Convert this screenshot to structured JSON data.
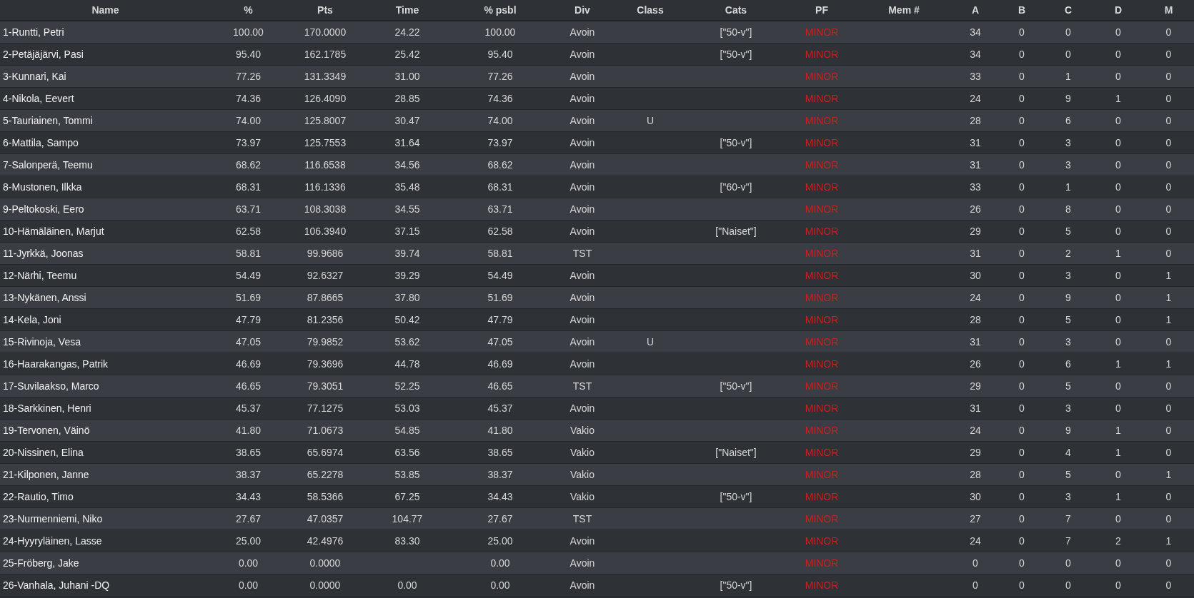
{
  "table": {
    "columns": [
      {
        "label": "Name",
        "kind": "text"
      },
      {
        "label": "%",
        "kind": "number"
      },
      {
        "label": "Pts",
        "kind": "number"
      },
      {
        "label": "Time",
        "kind": "number"
      },
      {
        "label": "% psbl",
        "kind": "number"
      },
      {
        "label": "Div",
        "kind": "number"
      },
      {
        "label": "Class",
        "kind": "number"
      },
      {
        "label": "Cats",
        "kind": "number"
      },
      {
        "label": "PF",
        "kind": "flag"
      },
      {
        "label": "Mem #",
        "kind": "number"
      },
      {
        "label": "A",
        "kind": "number"
      },
      {
        "label": "B",
        "kind": "number"
      },
      {
        "label": "C",
        "kind": "number"
      },
      {
        "label": "D",
        "kind": "number"
      },
      {
        "label": "M",
        "kind": "number"
      }
    ],
    "rows": [
      {
        "cells": [
          "1-Runtti, Petri",
          "100.00",
          "170.0000",
          "24.22",
          "100.00",
          "Avoin",
          null,
          "[\"50-v\"]",
          "MINOR",
          null,
          "34",
          "0",
          "0",
          "0",
          "0"
        ]
      },
      {
        "cells": [
          "2-Petäjäjärvi, Pasi",
          "95.40",
          "162.1785",
          "25.42",
          "95.40",
          "Avoin",
          null,
          "[\"50-v\"]",
          "MINOR",
          null,
          "34",
          "0",
          "0",
          "0",
          "0"
        ]
      },
      {
        "cells": [
          "3-Kunnari, Kai",
          "77.26",
          "131.3349",
          "31.00",
          "77.26",
          "Avoin",
          null,
          null,
          "MINOR",
          null,
          "33",
          "0",
          "1",
          "0",
          "0"
        ]
      },
      {
        "cells": [
          "4-Nikola, Eevert",
          "74.36",
          "126.4090",
          "28.85",
          "74.36",
          "Avoin",
          null,
          null,
          "MINOR",
          null,
          "24",
          "0",
          "9",
          "1",
          "0"
        ]
      },
      {
        "cells": [
          "5-Tauriainen, Tommi",
          "74.00",
          "125.8007",
          "30.47",
          "74.00",
          "Avoin",
          "U",
          null,
          "MINOR",
          null,
          "28",
          "0",
          "6",
          "0",
          "0"
        ]
      },
      {
        "cells": [
          "6-Mattila, Sampo",
          "73.97",
          "125.7553",
          "31.64",
          "73.97",
          "Avoin",
          null,
          "[\"50-v\"]",
          "MINOR",
          null,
          "31",
          "0",
          "3",
          "0",
          "0"
        ]
      },
      {
        "cells": [
          "7-Salonperä, Teemu",
          "68.62",
          "116.6538",
          "34.56",
          "68.62",
          "Avoin",
          null,
          null,
          "MINOR",
          null,
          "31",
          "0",
          "3",
          "0",
          "0"
        ]
      },
      {
        "cells": [
          "8-Mustonen, Ilkka",
          "68.31",
          "116.1336",
          "35.48",
          "68.31",
          "Avoin",
          null,
          "[\"60-v\"]",
          "MINOR",
          null,
          "33",
          "0",
          "1",
          "0",
          "0"
        ]
      },
      {
        "cells": [
          "9-Peltokoski, Eero",
          "63.71",
          "108.3038",
          "34.55",
          "63.71",
          "Avoin",
          null,
          null,
          "MINOR",
          null,
          "26",
          "0",
          "8",
          "0",
          "0"
        ]
      },
      {
        "cells": [
          "10-Hämäläinen, Marjut",
          "62.58",
          "106.3940",
          "37.15",
          "62.58",
          "Avoin",
          null,
          "[\"Naiset\"]",
          "MINOR",
          null,
          "29",
          "0",
          "5",
          "0",
          "0"
        ]
      },
      {
        "cells": [
          "11-Jyrkkä, Joonas",
          "58.81",
          "99.9686",
          "39.74",
          "58.81",
          "TST",
          null,
          null,
          "MINOR",
          null,
          "31",
          "0",
          "2",
          "1",
          "0"
        ]
      },
      {
        "cells": [
          "12-Närhi, Teemu",
          "54.49",
          "92.6327",
          "39.29",
          "54.49",
          "Avoin",
          null,
          null,
          "MINOR",
          null,
          "30",
          "0",
          "3",
          "0",
          "1"
        ]
      },
      {
        "cells": [
          "13-Nykänen, Anssi",
          "51.69",
          "87.8665",
          "37.80",
          "51.69",
          "Avoin",
          null,
          null,
          "MINOR",
          null,
          "24",
          "0",
          "9",
          "0",
          "1"
        ]
      },
      {
        "cells": [
          "14-Kela, Joni",
          "47.79",
          "81.2356",
          "50.42",
          "47.79",
          "Avoin",
          null,
          null,
          "MINOR",
          null,
          "28",
          "0",
          "5",
          "0",
          "1"
        ]
      },
      {
        "cells": [
          "15-Rivinoja, Vesa",
          "47.05",
          "79.9852",
          "53.62",
          "47.05",
          "Avoin",
          "U",
          null,
          "MINOR",
          null,
          "31",
          "0",
          "3",
          "0",
          "0"
        ]
      },
      {
        "cells": [
          "16-Haarakangas, Patrik",
          "46.69",
          "79.3696",
          "44.78",
          "46.69",
          "Avoin",
          null,
          null,
          "MINOR",
          null,
          "26",
          "0",
          "6",
          "1",
          "1"
        ]
      },
      {
        "cells": [
          "17-Suvilaakso, Marco",
          "46.65",
          "79.3051",
          "52.25",
          "46.65",
          "TST",
          null,
          "[\"50-v\"]",
          "MINOR",
          null,
          "29",
          "0",
          "5",
          "0",
          "0"
        ]
      },
      {
        "cells": [
          "18-Sarkkinen, Henri",
          "45.37",
          "77.1275",
          "53.03",
          "45.37",
          "Avoin",
          null,
          null,
          "MINOR",
          null,
          "31",
          "0",
          "3",
          "0",
          "0"
        ]
      },
      {
        "cells": [
          "19-Tervonen, Väinö",
          "41.80",
          "71.0673",
          "54.85",
          "41.80",
          "Vakio",
          null,
          null,
          "MINOR",
          null,
          "24",
          "0",
          "9",
          "1",
          "0"
        ]
      },
      {
        "cells": [
          "20-Nissinen, Elina",
          "38.65",
          "65.6974",
          "63.56",
          "38.65",
          "Vakio",
          null,
          "[\"Naiset\"]",
          "MINOR",
          null,
          "29",
          "0",
          "4",
          "1",
          "0"
        ]
      },
      {
        "cells": [
          "21-Kilponen, Janne",
          "38.37",
          "65.2278",
          "53.85",
          "38.37",
          "Vakio",
          null,
          null,
          "MINOR",
          null,
          "28",
          "0",
          "5",
          "0",
          "1"
        ]
      },
      {
        "cells": [
          "22-Rautio, Timo",
          "34.43",
          "58.5366",
          "67.25",
          "34.43",
          "Vakio",
          null,
          "[\"50-v\"]",
          "MINOR",
          null,
          "30",
          "0",
          "3",
          "1",
          "0"
        ]
      },
      {
        "cells": [
          "23-Nurmenniemi, Niko",
          "27.67",
          "47.0357",
          "104.77",
          "27.67",
          "TST",
          null,
          null,
          "MINOR",
          null,
          "27",
          "0",
          "7",
          "0",
          "0"
        ]
      },
      {
        "cells": [
          "24-Hyyryläinen, Lasse",
          "25.00",
          "42.4976",
          "83.30",
          "25.00",
          "Avoin",
          null,
          null,
          "MINOR",
          null,
          "24",
          "0",
          "7",
          "2",
          "1"
        ]
      },
      {
        "cells": [
          "25-Fröberg, Jake",
          "0.00",
          "0.0000",
          null,
          "0.00",
          "Avoin",
          null,
          null,
          "MINOR",
          null,
          "0",
          "0",
          "0",
          "0",
          "0"
        ]
      },
      {
        "cells": [
          "26-Vanhala, Juhani -DQ",
          "0.00",
          "0.0000",
          "0.00",
          "0.00",
          "Avoin",
          null,
          "[\"50-v\"]",
          "MINOR",
          null,
          "0",
          "0",
          "0",
          "0",
          "0"
        ]
      }
    ]
  }
}
